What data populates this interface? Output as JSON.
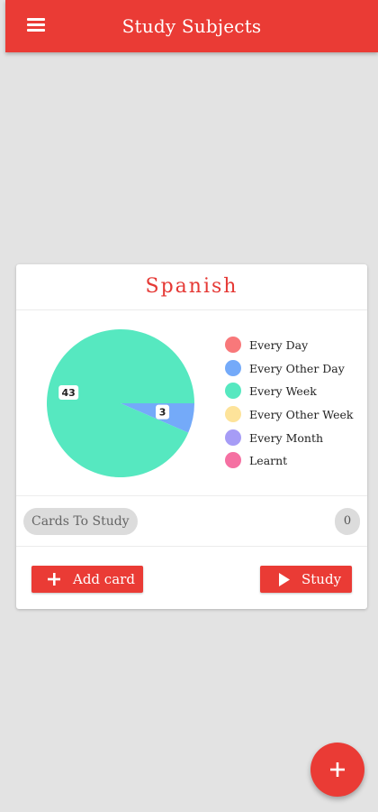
{
  "appbar": {
    "title": "Study Subjects",
    "menu_icon": "hamburger-menu-icon"
  },
  "card": {
    "title": "Spanish",
    "title_color": "#e53935",
    "cards_to_study_label": "Cards To Study",
    "cards_to_study_count": "0",
    "add_card_label": "Add card",
    "study_label": "Study"
  },
  "chart_data": {
    "type": "pie",
    "slices": [
      {
        "label": "Every Day",
        "value": 0,
        "color": "#f8787a"
      },
      {
        "label": "Every Other Day",
        "value": 3,
        "color": "#74aaf9"
      },
      {
        "label": "Every Week",
        "value": 43,
        "color": "#56e8c0"
      },
      {
        "label": "Every Other Week",
        "value": 0,
        "color": "#fde39a"
      },
      {
        "label": "Every Month",
        "value": 0,
        "color": "#a69cf6"
      },
      {
        "label": "Learnt",
        "value": 0,
        "color": "#f570a2"
      }
    ],
    "data_labels": [
      "43",
      "3"
    ],
    "legend_position": "right"
  },
  "fab": {
    "icon": "plus-icon"
  },
  "colors": {
    "primary": "#ea3b35",
    "background": "#e3e3e3"
  }
}
